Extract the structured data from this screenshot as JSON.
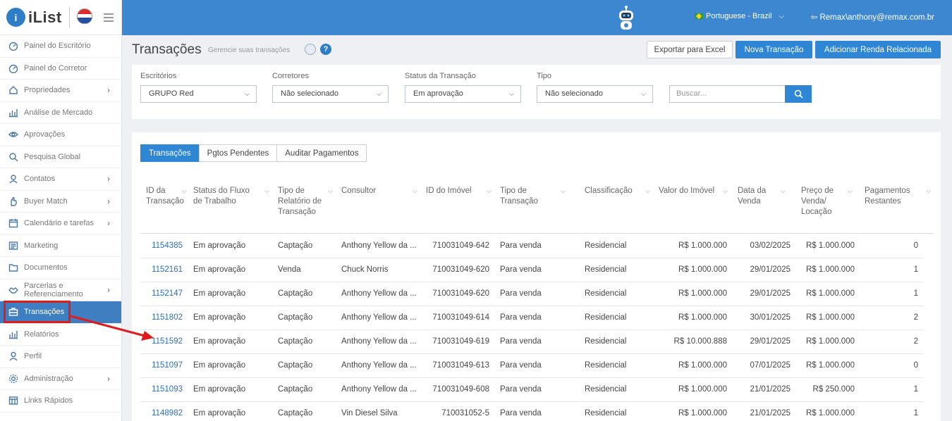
{
  "brand": {
    "logo_text": "iList"
  },
  "sidebar": {
    "items": [
      {
        "label": "Painel do Escritório",
        "icon": "gauge-icon",
        "chevron": false
      },
      {
        "label": "Painel do Corretor",
        "icon": "gauge-icon",
        "chevron": false
      },
      {
        "label": "Propriedades",
        "icon": "home-icon",
        "chevron": true
      },
      {
        "label": "Análise de Mercado",
        "icon": "bar-chart-icon",
        "chevron": false
      },
      {
        "label": "Aprovações",
        "icon": "eye-icon",
        "chevron": false
      },
      {
        "label": "Pesquisa Global",
        "icon": "search-icon",
        "chevron": false
      },
      {
        "label": "Contatos",
        "icon": "contacts-icon",
        "chevron": true
      },
      {
        "label": "Buyer Match",
        "icon": "hand-icon",
        "chevron": true
      },
      {
        "label": "Calendário e tarefas",
        "icon": "calendar-icon",
        "chevron": true
      },
      {
        "label": "Marketing",
        "icon": "newspaper-icon",
        "chevron": false
      },
      {
        "label": "Documentos",
        "icon": "folder-icon",
        "chevron": false
      },
      {
        "label": "Parcerias e Referenciamento",
        "icon": "handshake-icon",
        "chevron": true
      },
      {
        "label": "Transações",
        "icon": "briefcase-icon",
        "chevron": false,
        "active": true
      },
      {
        "label": "Relatórios",
        "icon": "bar-chart-icon",
        "chevron": false
      },
      {
        "label": "Perfil",
        "icon": "user-icon",
        "chevron": false
      },
      {
        "label": "Administração",
        "icon": "gear-icon",
        "chevron": true
      },
      {
        "label": "Links Rápidos",
        "icon": "grid-icon",
        "chevron": false
      }
    ]
  },
  "topbar": {
    "language": "Portuguese - Brazil",
    "user": "Remax\\anthony@remax.com.br"
  },
  "header": {
    "title": "Transações",
    "subtitle": "Gerencie suas transações",
    "export_label": "Exportar para Excel",
    "new_label": "Nova Transação",
    "add_income_label": "Adicionar Renda Relacionada"
  },
  "filters": {
    "offices_label": "Escritórios",
    "offices_value": "GRUPO Red",
    "brokers_label": "Corretores",
    "brokers_value": "Não selecionado",
    "status_label": "Status da Transação",
    "status_value": "Em aprovação",
    "type_label": "Tipo",
    "type_value": "Não selecionado",
    "search_placeholder": "Buscar..."
  },
  "tabs": [
    "Transações",
    "Pgtos Pendentes",
    "Auditar Pagamentos"
  ],
  "table": {
    "headers": [
      "ID da Transação",
      "Status do Fluxo de Trabalho",
      "Tipo de Relatório de Transação",
      "Consultor",
      "ID do Imóvel",
      "Tipo de Transação",
      "Classificação",
      "Valor do Imóvel",
      "Data da Venda",
      "Preço de Venda/ Locação",
      "Pagamentos Restantes"
    ],
    "rows": [
      {
        "id": "1154385",
        "status": "Em aprovação",
        "report": "Captação",
        "consultant": "Anthony Yellow da ...",
        "property": "710031049-642",
        "type": "Para venda",
        "class": "Residencial",
        "value": "R$ 1.000.000",
        "date": "03/02/2025",
        "price": "R$ 1.000.000",
        "remaining": "0"
      },
      {
        "id": "1152161",
        "status": "Em aprovação",
        "report": "Venda",
        "consultant": "Chuck Norris",
        "property": "710031049-620",
        "type": "Para venda",
        "class": "Residencial",
        "value": "R$ 1.000.000",
        "date": "29/01/2025",
        "price": "R$ 1.000.000",
        "remaining": "1"
      },
      {
        "id": "1152147",
        "status": "Em aprovação",
        "report": "Captação",
        "consultant": "Anthony Yellow da ...",
        "property": "710031049-620",
        "type": "Para venda",
        "class": "Residencial",
        "value": "R$ 1.000.000",
        "date": "29/01/2025",
        "price": "R$ 1.000.000",
        "remaining": "1"
      },
      {
        "id": "1151802",
        "status": "Em aprovação",
        "report": "Captação",
        "consultant": "Anthony Yellow da ...",
        "property": "710031049-614",
        "type": "Para venda",
        "class": "Residencial",
        "value": "R$ 1.000.000",
        "date": "30/01/2025",
        "price": "R$ 1.000.000",
        "remaining": "2"
      },
      {
        "id": "1151592",
        "status": "Em aprovação",
        "report": "Captação",
        "consultant": "Anthony Yellow da ...",
        "property": "710031049-619",
        "type": "Para venda",
        "class": "Residencial",
        "value": "R$ 10.000.888",
        "date": "29/01/2025",
        "price": "R$ 1.000.000",
        "remaining": "2"
      },
      {
        "id": "1151097",
        "status": "Em aprovação",
        "report": "Captação",
        "consultant": "Anthony Yellow da ...",
        "property": "710031049-613",
        "type": "Para venda",
        "class": "Residencial",
        "value": "R$ 1.000.000",
        "date": "07/01/2025",
        "price": "R$ 1.000.000",
        "remaining": "0"
      },
      {
        "id": "1151093",
        "status": "Em aprovação",
        "report": "Captação",
        "consultant": "Anthony Yellow da ...",
        "property": "710031049-608",
        "type": "Para venda",
        "class": "Residencial",
        "value": "R$ 1.000.000",
        "date": "21/01/2025",
        "price": "R$ 250.000",
        "remaining": "1"
      },
      {
        "id": "1148982",
        "status": "Em aprovação",
        "report": "Captação",
        "consultant": "Vin Diesel Silva",
        "property": "710031052-5",
        "type": "Para venda",
        "class": "Residencial",
        "value": "R$ 1.000.000",
        "date": "21/01/2025",
        "price": "R$ 1.000.000",
        "remaining": "1"
      }
    ]
  },
  "annotation": {
    "color": "#e01b1b"
  }
}
